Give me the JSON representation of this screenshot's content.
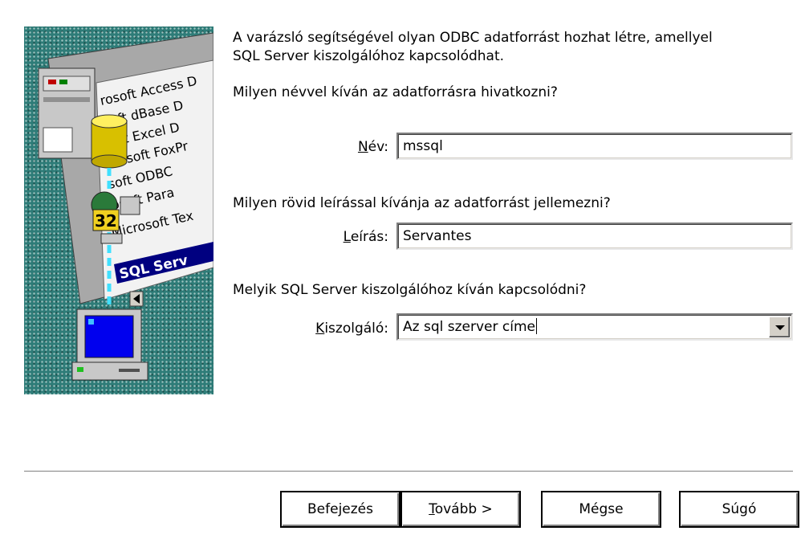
{
  "intro": {
    "line1": "A varázsló segítségével olyan ODBC adatforrást hozhat létre, amellyel",
    "line2": "SQL Server kiszolgálóhoz kapcsolódhat."
  },
  "name_section": {
    "question": "Milyen névvel kíván az adatforrásra hivatkozni?",
    "label_mnemonic": "N",
    "label_rest": "év:",
    "value": "mssql"
  },
  "desc_section": {
    "question": "Milyen rövid leírással kívánja az adatforrást jellemezni?",
    "label_mnemonic": "L",
    "label_rest": "eírás:",
    "value": "Servantes"
  },
  "server_section": {
    "question": "Melyik SQL Server kiszolgálóhoz kíván kapcsolódni?",
    "label_mnemonic": "K",
    "label_rest": "iszolgáló:",
    "value": "Az sql szerver címe"
  },
  "illustration": {
    "list_items": [
      "rosoft Access D",
      "soft dBase D",
      "soft Excel D",
      "icrosoft FoxPr",
      "soft ODBC",
      "osoft Para",
      "Microsoft Tex",
      "SQL Serv"
    ],
    "badge": "32"
  },
  "buttons": {
    "finish": "Befejezés",
    "next_mnemonic": "T",
    "next_rest": "ovább >",
    "cancel": "Mégse",
    "help": "Súgó"
  },
  "colors": {
    "illustration_bg": "#2e7c78",
    "highlight": "#000080",
    "dialog_bg": "#ffffff"
  }
}
